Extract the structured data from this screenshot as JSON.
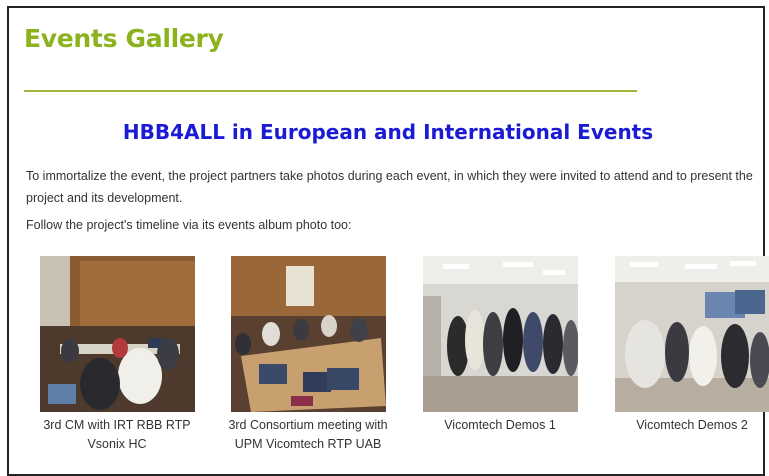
{
  "header": {
    "title": "Events Gallery"
  },
  "main": {
    "heading": "HBB4ALL in European and International Events",
    "intro": "To immortalize the event, the project partners take photos during each event, in which they were invited to attend and to present the project and its development.",
    "follow": "Follow the project's timeline via its events album photo too:"
  },
  "gallery": {
    "items": [
      {
        "caption": "3rd CM with IRT RBB RTP Vsonix HC",
        "icon": "meeting-room-photo"
      },
      {
        "caption": "3rd Consortium meeting with UPM Vicomtech RTP UAB",
        "icon": "meeting-table-photo"
      },
      {
        "caption": "Vicomtech Demos 1",
        "icon": "demo-crowd-photo"
      },
      {
        "caption": "Vicomtech Demos 2",
        "icon": "demo-crowd-photo"
      }
    ]
  },
  "colors": {
    "title": "#8cb31e",
    "heading": "#1b1bd6",
    "rule": "#9bb83a",
    "text": "#333333"
  }
}
